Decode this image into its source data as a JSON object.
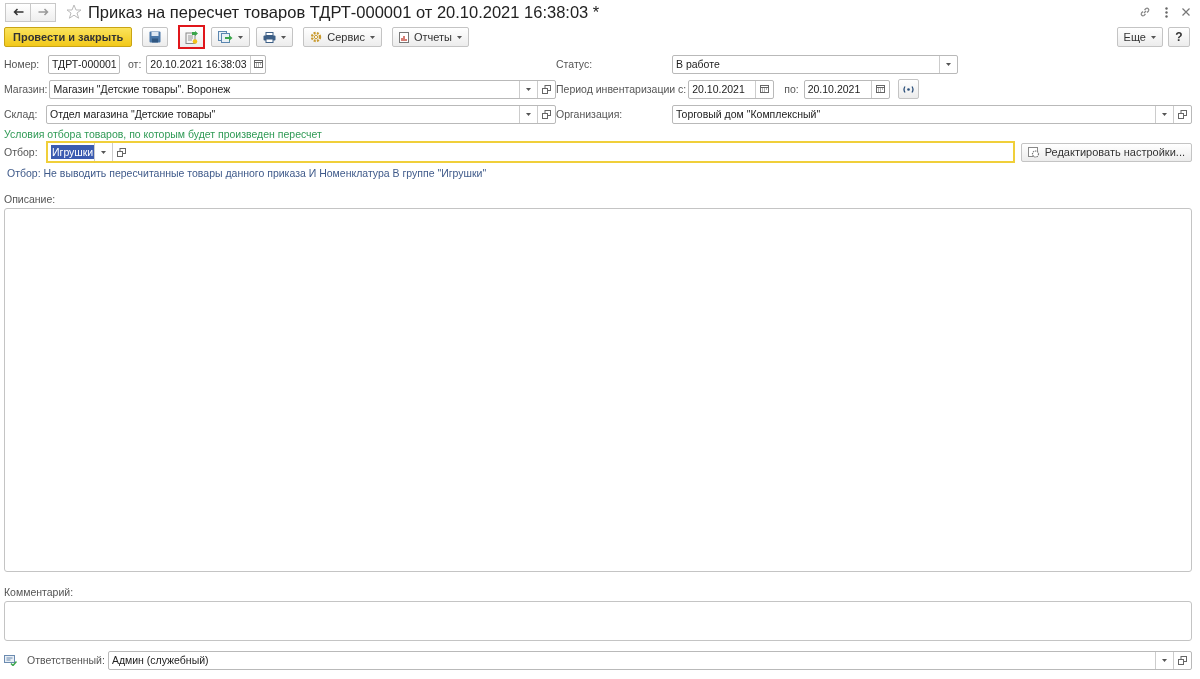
{
  "window": {
    "title": "Приказ на пересчет товаров ТДРТ-000001 от 20.10.2021 16:38:03 *"
  },
  "toolbar": {
    "items": [
      {
        "kind": "primary",
        "label": "Провести и закрыть",
        "highlighted": false
      },
      {
        "kind": "save",
        "highlighted": false
      },
      {
        "kind": "post",
        "highlighted": true
      },
      {
        "kind": "create",
        "highlighted": false
      },
      {
        "kind": "print",
        "highlighted": false
      },
      {
        "kind": "service",
        "label": "Сервис",
        "highlighted": false
      },
      {
        "kind": "reports",
        "label": "Отчеты",
        "highlighted": false
      }
    ],
    "more": {
      "label": "Еще"
    },
    "help": {
      "label": "?"
    }
  },
  "header": {
    "number": {
      "label": "Номер:",
      "value": "ТДРТ-000001"
    },
    "date": {
      "label": "от:",
      "value": "20.10.2021 16:38:03"
    },
    "status": {
      "label": "Статус:",
      "value": "В работе"
    },
    "store": {
      "label": "Магазин:",
      "value": "Магазин \"Детские товары\". Воронеж"
    },
    "period": {
      "label": "Период инвентаризации с:",
      "from": "20.10.2021",
      "to_label": "по:",
      "to": "20.10.2021"
    },
    "warehouse": {
      "label": "Склад:",
      "value": "Отдел магазина \"Детские товары\""
    },
    "organization": {
      "label": "Организация:",
      "value": "Торговый дом \"Комплексный\""
    }
  },
  "filter": {
    "hint": "Условия отбора товаров, по которым будет произведен пересчет",
    "label": "Отбор:",
    "value": "Игрушки",
    "value_selected": true,
    "focused": true,
    "settings_button": "Редактировать настройки...",
    "summary": "Отбор: Не выводить пересчитанные товары данного приказа И Номенклатура В группе \"Игрушки\""
  },
  "description": {
    "label": "Описание:"
  },
  "comment": {
    "label": "Комментарий:"
  },
  "responsible": {
    "label": "Ответственный:",
    "value": "Админ (служебный)"
  }
}
